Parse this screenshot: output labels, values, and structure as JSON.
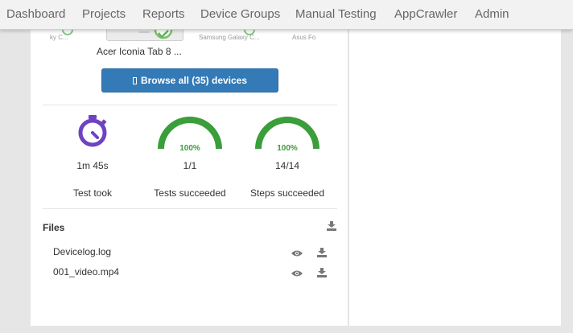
{
  "nav": {
    "items": [
      "Dashboard",
      "Projects",
      "Reports",
      "Device Groups",
      "Manual Testing",
      "AppCrawler",
      "Admin"
    ]
  },
  "devices": {
    "left_partial": "ky C...",
    "main_name": "Acer Iconia Tab 8 ...",
    "right_name": "Samsung Galaxy C...",
    "far_right_name": "Asus Fo",
    "browse_label": "Browse all (35) devices"
  },
  "stats": {
    "duration": {
      "value": "1m 45s",
      "label": "Test took",
      "icon": "stopwatch-icon"
    },
    "tests": {
      "percent": "100%",
      "percent_value": 100,
      "value": "1/1",
      "label": "Tests succeeded"
    },
    "steps": {
      "percent": "100%",
      "percent_value": 100,
      "value": "14/14",
      "label": "Steps succeeded"
    }
  },
  "files": {
    "title": "Files",
    "items": [
      {
        "name": "Devicelog.log"
      },
      {
        "name": "001_video.mp4"
      }
    ]
  },
  "colors": {
    "brand_blue": "#337ab7",
    "success_green": "#3a9e3a",
    "stopwatch_purple": "#6f42c1"
  }
}
